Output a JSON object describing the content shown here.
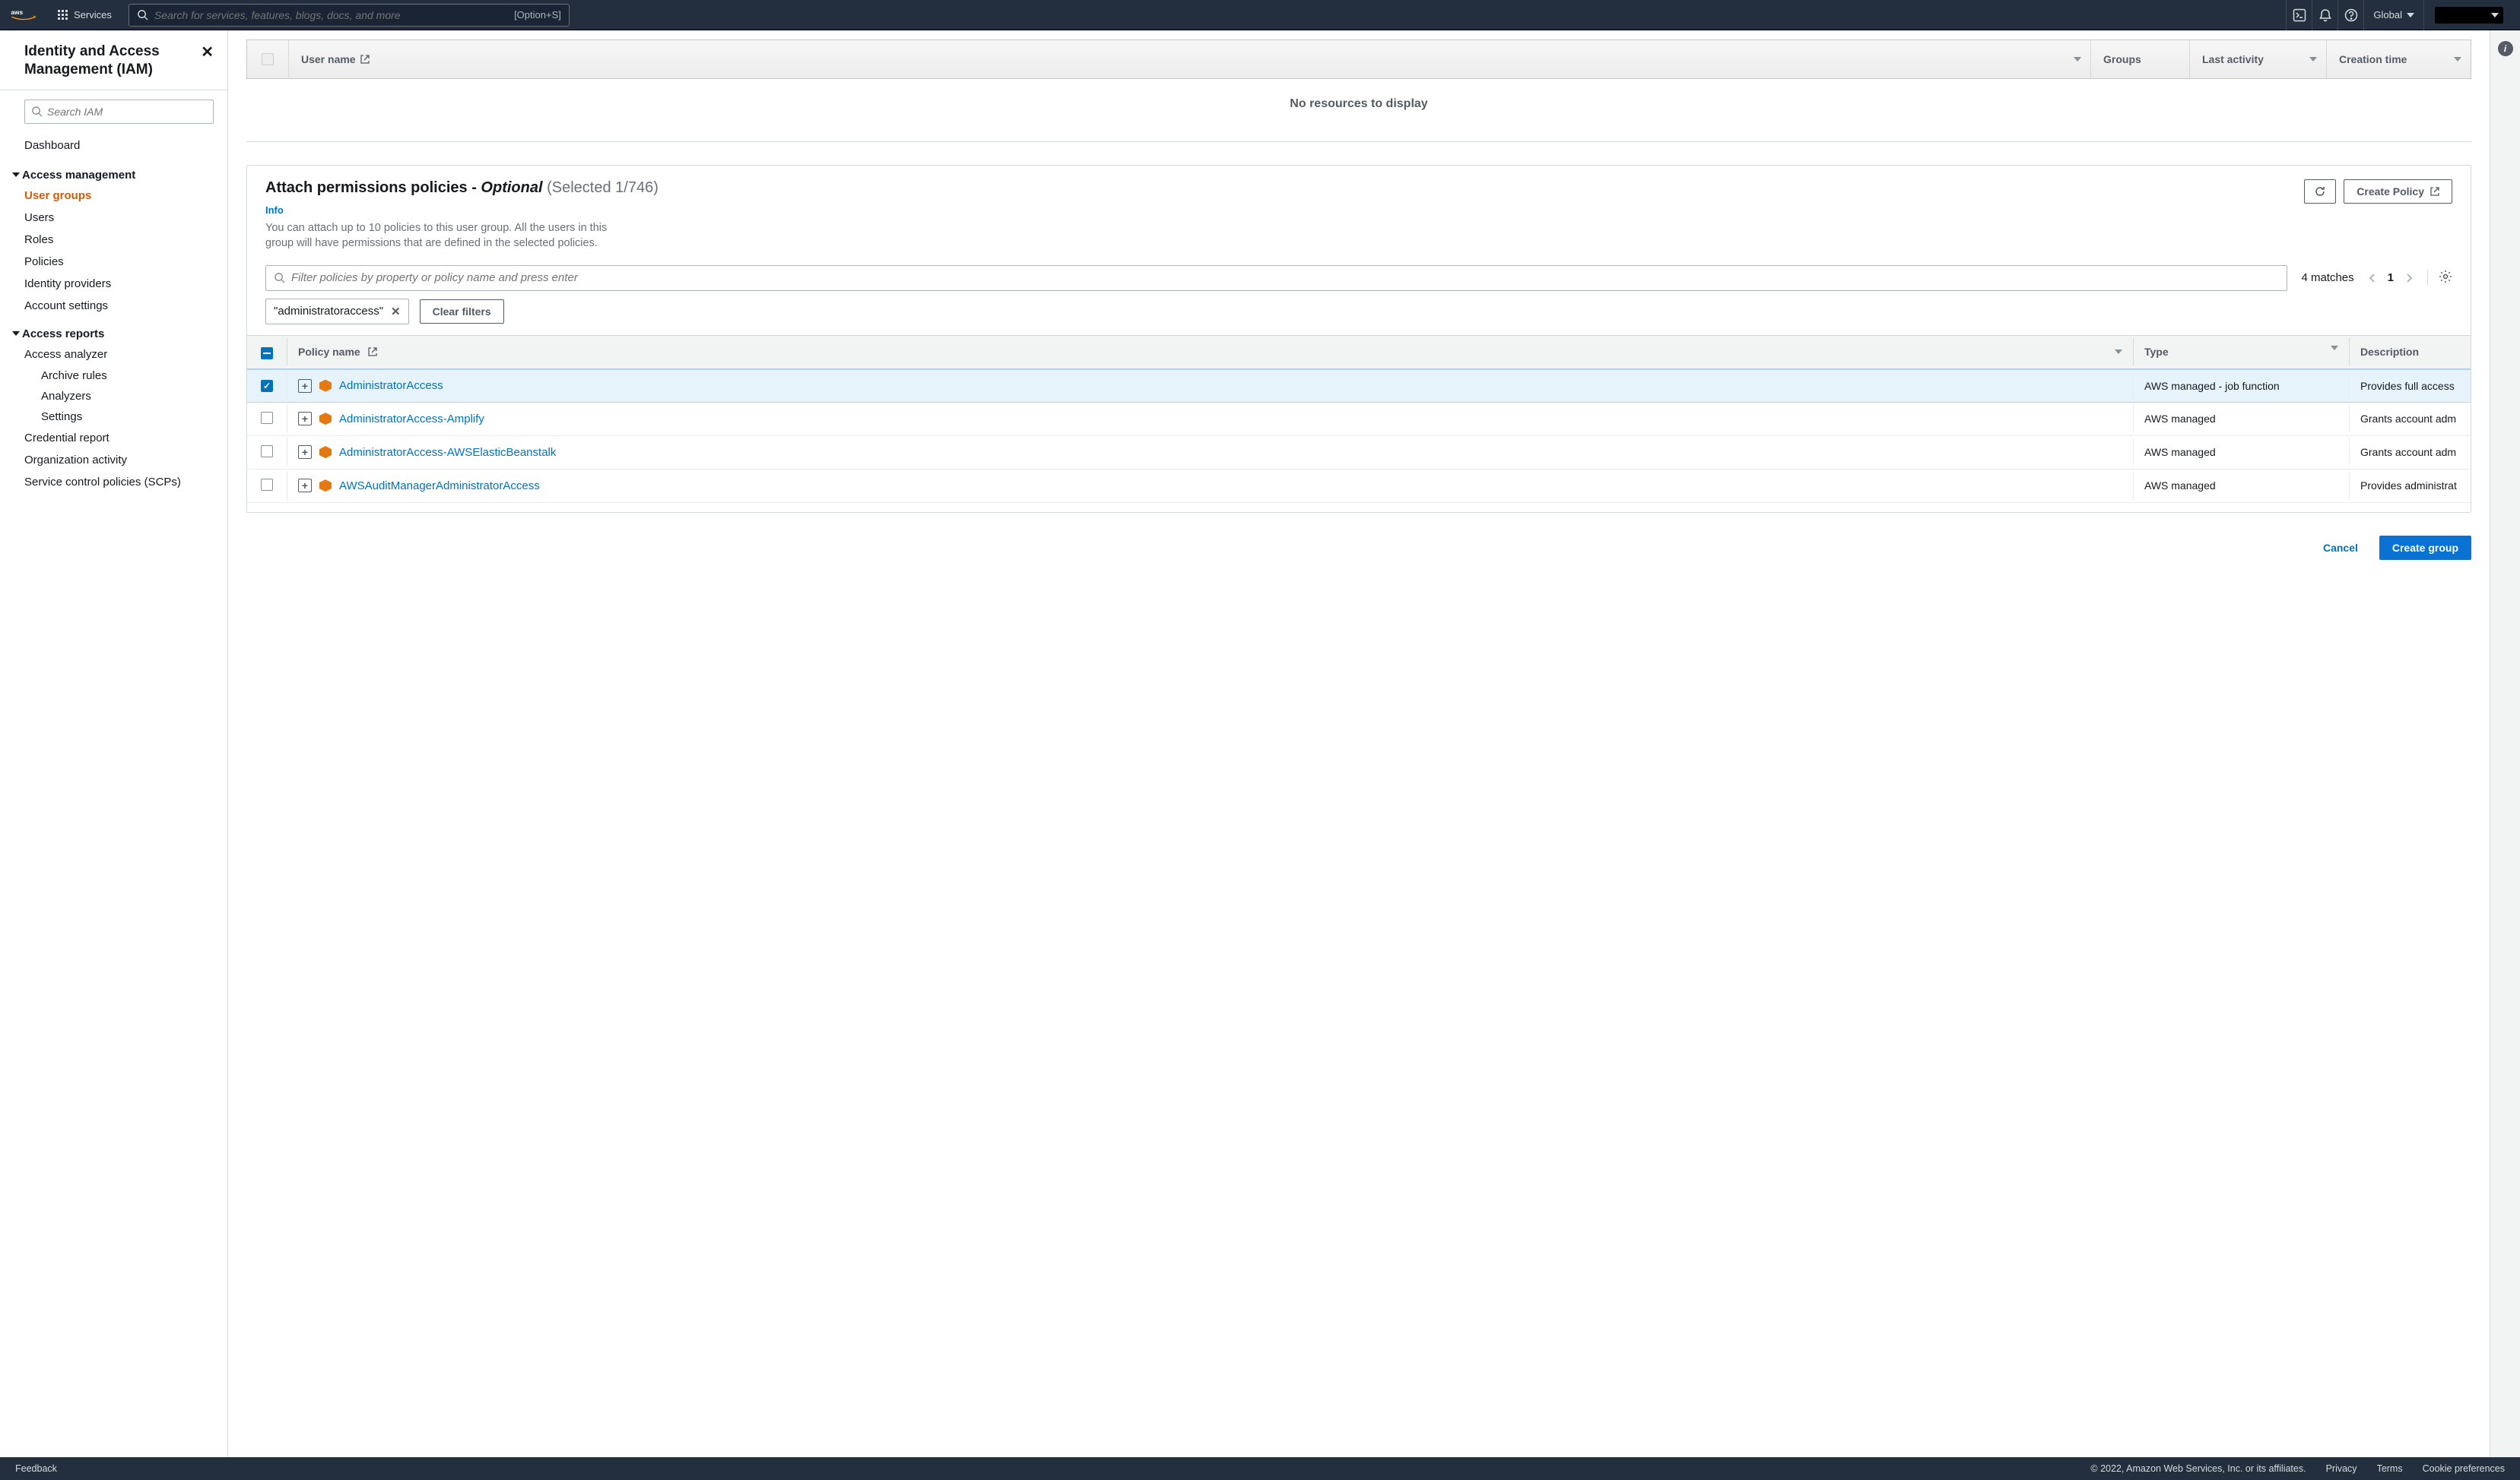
{
  "topnav": {
    "services": "Services",
    "search_placeholder": "Search for services, features, blogs, docs, and more",
    "search_shortcut": "[Option+S]",
    "region": "Global"
  },
  "sidebar": {
    "title": "Identity and Access Management (IAM)",
    "search_placeholder": "Search IAM",
    "dashboard": "Dashboard",
    "section_access_mgmt": "Access management",
    "items_mgmt": {
      "user_groups": "User groups",
      "users": "Users",
      "roles": "Roles",
      "policies": "Policies",
      "idp": "Identity providers",
      "account_settings": "Account settings"
    },
    "section_reports": "Access reports",
    "items_reports": {
      "analyzer": "Access analyzer",
      "archive_rules": "Archive rules",
      "analyzers": "Analyzers",
      "settings": "Settings",
      "cred_report": "Credential report",
      "org_activity": "Organization activity",
      "scps": "Service control policies (SCPs)"
    }
  },
  "users_table": {
    "h_user": "User name",
    "h_groups": "Groups",
    "h_last": "Last activity",
    "h_created": "Creation time",
    "empty": "No resources to display"
  },
  "attach": {
    "title_prefix": "Attach permissions policies - ",
    "title_optional": "Optional",
    "selected": "(Selected 1/746)",
    "info": "Info",
    "desc": "You can attach up to 10 policies to this user group. All the users in this group will have permissions that are defined in the selected policies.",
    "refresh": "Refresh",
    "create_policy": "Create Policy",
    "filter_placeholder": "Filter policies by property or policy name and press enter",
    "matches": "4 matches",
    "page": "1",
    "chip": "\"administratoraccess\"",
    "clear_filters": "Clear filters"
  },
  "policy_table": {
    "h_name": "Policy name",
    "h_type": "Type",
    "h_desc": "Description",
    "rows": [
      {
        "name": "AdministratorAccess",
        "type": "AWS managed - job function",
        "desc": "Provides full access",
        "checked": true
      },
      {
        "name": "AdministratorAccess-Amplify",
        "type": "AWS managed",
        "desc": "Grants account adm",
        "checked": false
      },
      {
        "name": "AdministratorAccess-AWSElasticBeanstalk",
        "type": "AWS managed",
        "desc": "Grants account adm",
        "checked": false
      },
      {
        "name": "AWSAuditManagerAdministratorAccess",
        "type": "AWS managed",
        "desc": "Provides administrat",
        "checked": false
      }
    ]
  },
  "actions": {
    "cancel": "Cancel",
    "create_group": "Create group"
  },
  "footer": {
    "feedback": "Feedback",
    "copyright": "© 2022, Amazon Web Services, Inc. or its affiliates.",
    "privacy": "Privacy",
    "terms": "Terms",
    "cookies": "Cookie preferences"
  }
}
